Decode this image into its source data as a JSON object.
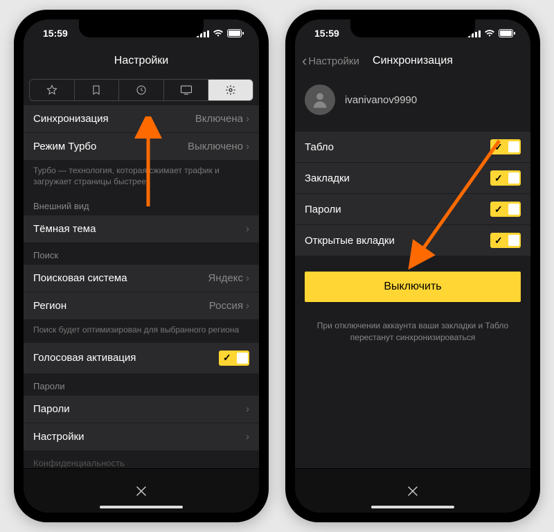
{
  "status": {
    "time": "15:59"
  },
  "left": {
    "title": "Настройки",
    "sync": {
      "label": "Синхронизация",
      "value": "Включена"
    },
    "turbo": {
      "label": "Режим Турбо",
      "value": "Выключено"
    },
    "turbo_note": "Турбо — технология, которая сжимает трафик и загружает страницы быстрее",
    "appearance_header": "Внешний вид",
    "dark": {
      "label": "Тёмная тема"
    },
    "search_header": "Поиск",
    "engine": {
      "label": "Поисковая система",
      "value": "Яндекс"
    },
    "region": {
      "label": "Регион",
      "value": "Россия"
    },
    "region_note": "Поиск будет оптимизирован для выбранного региона",
    "voice": {
      "label": "Голосовая активация"
    },
    "passwords_header": "Пароли",
    "passwords": {
      "label": "Пароли"
    },
    "settings2": {
      "label": "Настройки"
    },
    "privacy": {
      "label": "Конфиденциальность"
    }
  },
  "right": {
    "back": "Настройки",
    "title": "Синхронизация",
    "username": "ivanivanov9990",
    "items": [
      {
        "label": "Табло"
      },
      {
        "label": "Закладки"
      },
      {
        "label": "Пароли"
      },
      {
        "label": "Открытые вкладки"
      }
    ],
    "button": "Выключить",
    "note": "При отключении аккаунта ваши закладки и Табло перестанут синхронизироваться"
  }
}
